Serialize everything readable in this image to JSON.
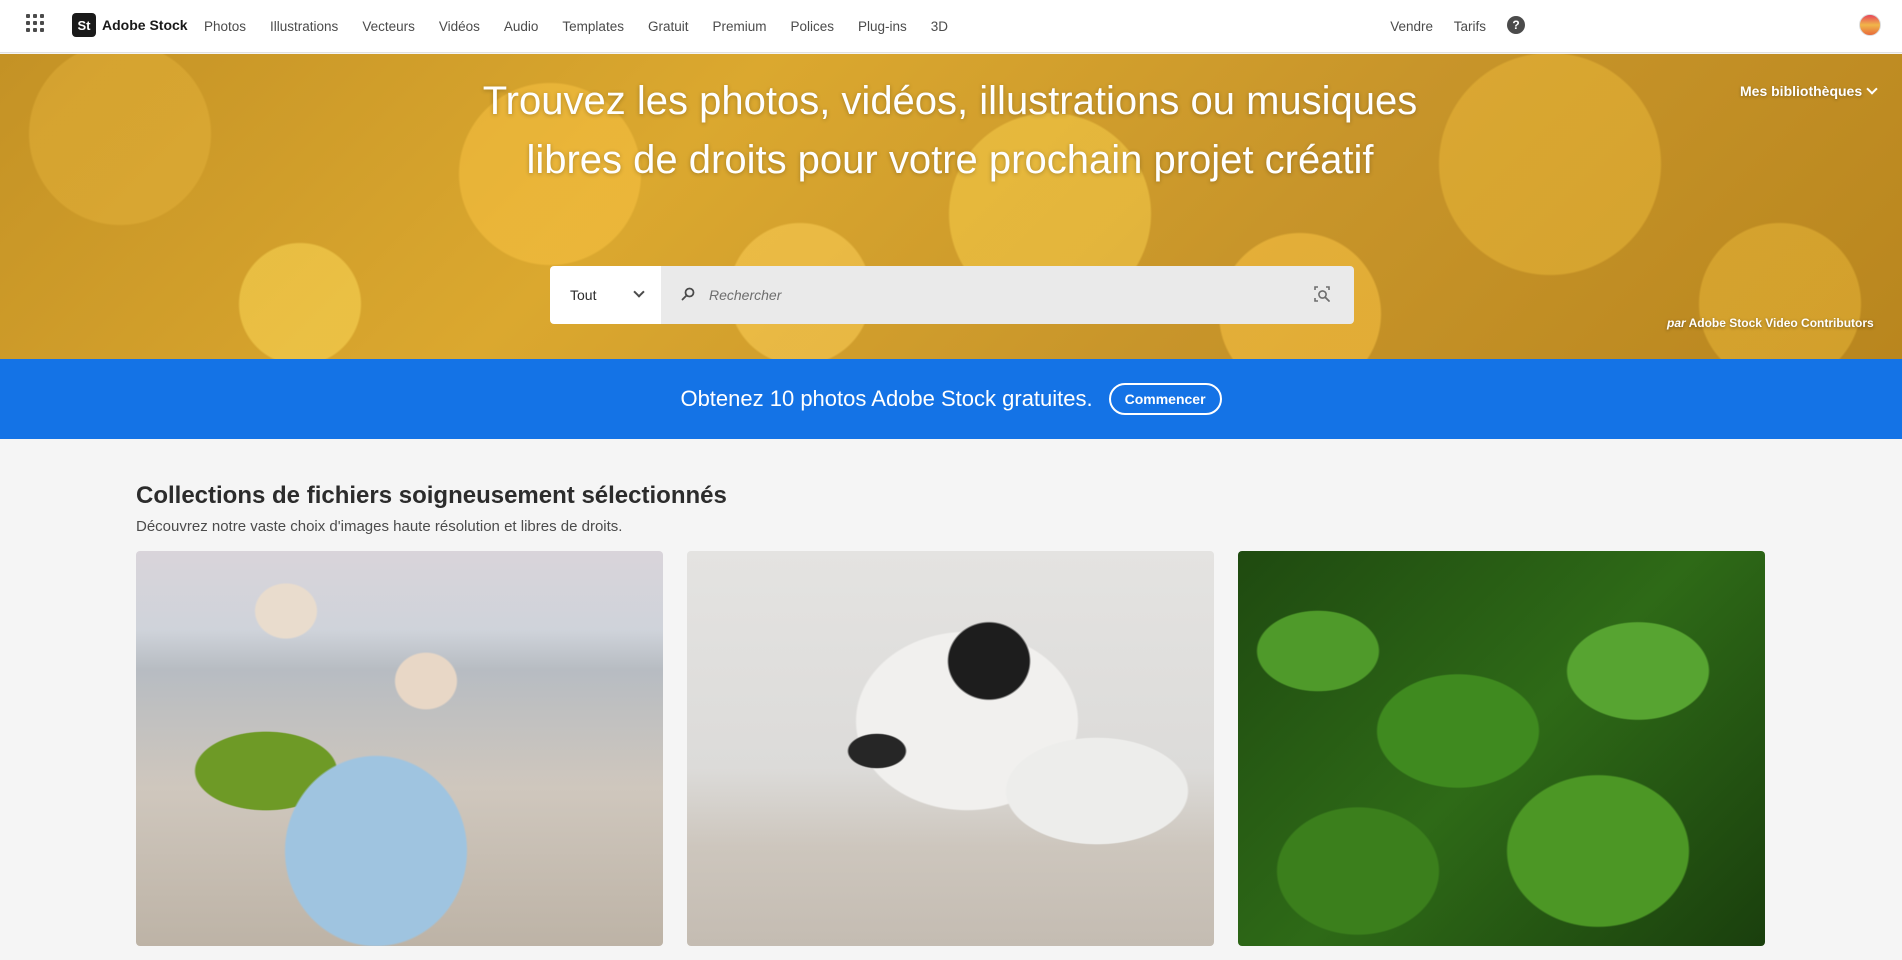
{
  "header": {
    "app_switcher_icon": "grid-icon",
    "logo_mark": "St",
    "logo_text": "Adobe Stock",
    "nav": [
      "Photos",
      "Illustrations",
      "Vecteurs",
      "Vidéos",
      "Audio",
      "Templates",
      "Gratuit",
      "Premium",
      "Polices",
      "Plug-ins",
      "3D"
    ],
    "sell_label": "Vendre",
    "pricing_label": "Tarifs",
    "help_icon": "question-icon",
    "avatar_icon": "avatar"
  },
  "hero": {
    "title": "Trouvez les photos, vidéos, illustrations ou musiques libres de droits pour votre prochain projet créatif",
    "libraries_label": "Mes bibliothèques",
    "category_value": "Tout",
    "search_placeholder": "Rechercher",
    "credit_prefix": "par",
    "credit_name": "Adobe Stock Video Contributors"
  },
  "promo": {
    "text": "Obtenez 10 photos Adobe Stock gratuites.",
    "button_label": "Commencer",
    "background_color": "#1473e6"
  },
  "collections": {
    "title": "Collections de fichiers soigneusement sélectionnés",
    "subtitle": "Découvrez notre vaste choix d'images haute résolution et libres de droits."
  }
}
